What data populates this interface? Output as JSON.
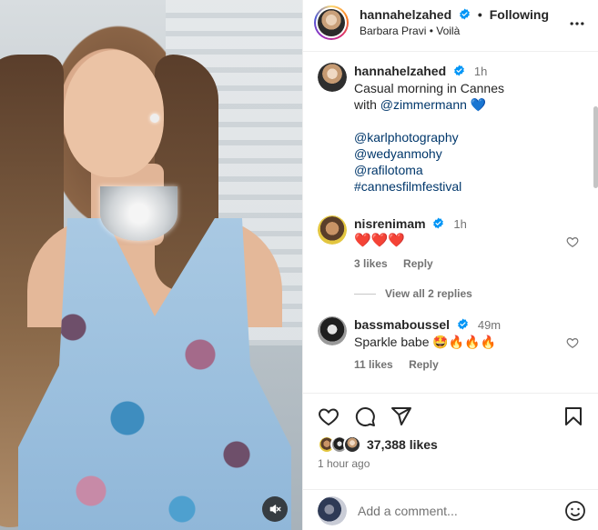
{
  "post": {
    "author": "hannahelzahed",
    "follow_label": "Following",
    "audio_line": "Barbara Pravi • Voilà",
    "caption": {
      "author": "hannahelzahed",
      "time": "1h",
      "line1": "Casual morning in Cannes",
      "line2_prefix": "with ",
      "mention": "@zimmermann",
      "emoji": "💙",
      "tags": [
        "@karlphotography",
        "@wedyanmohy",
        "@rafilotoma",
        "#cannesfilmfestival"
      ]
    }
  },
  "comments": [
    {
      "author": "nisrenimam",
      "time": "1h",
      "text": "❤️❤️❤️",
      "likes": "3 likes",
      "reply": "Reply",
      "view_replies": "View all 2 replies"
    },
    {
      "author": "bassmaboussel",
      "time": "49m",
      "text": "Sparkle babe 🤩🔥🔥🔥",
      "likes": "11 likes",
      "reply": "Reply"
    }
  ],
  "footer": {
    "likes": "37,388 likes",
    "posted": "1 hour ago",
    "add_comment_placeholder": "Add a comment..."
  },
  "icons": {
    "verified": "verified-badge-icon",
    "more": "more-horizontal-icon",
    "like": "heart-icon",
    "comment": "comment-icon",
    "share": "send-icon",
    "save": "bookmark-icon",
    "emoji": "emoji-icon",
    "mute": "muted-speaker-icon"
  },
  "colors": {
    "verified": "#0095f6",
    "link": "#00376b",
    "muted_text": "#737373",
    "heart_red": "#e0245e"
  }
}
